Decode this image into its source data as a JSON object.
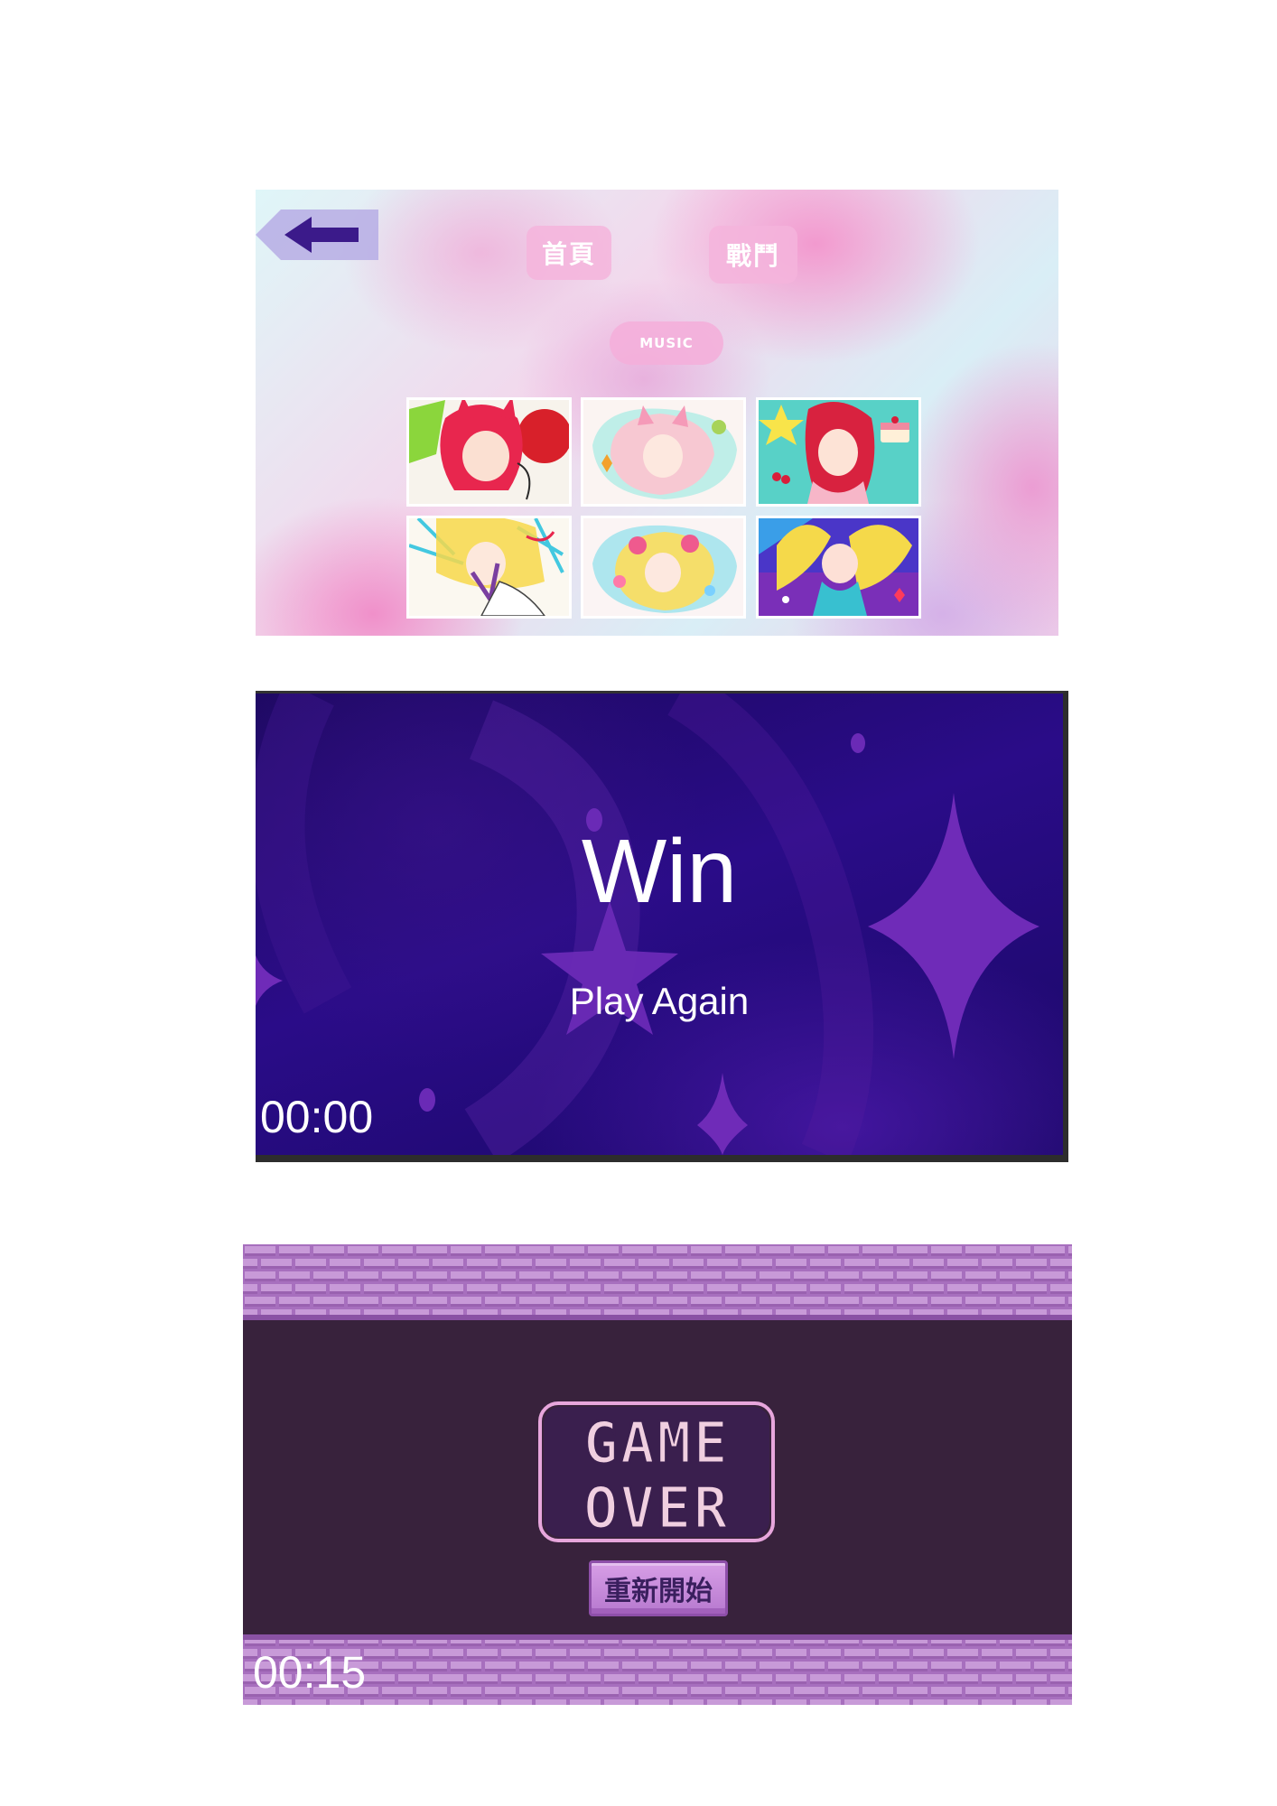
{
  "menu": {
    "back_icon": "left-arrow-icon",
    "home_label": "首頁",
    "battle_label": "戰鬥",
    "music_label": "MUSIC",
    "thumbnails": [
      {
        "name": "red-cat-girl-strawberry-art"
      },
      {
        "name": "pink-cat-girl-bowl-art"
      },
      {
        "name": "red-hair-girl-cake-art"
      },
      {
        "name": "blonde-girl-sketch-art"
      },
      {
        "name": "blonde-pink-girl-candy-art"
      },
      {
        "name": "blonde-twin-tails-girl-art"
      }
    ],
    "colors": {
      "button_pink": "#f4b4dc",
      "arrow": "#3b1a8a"
    }
  },
  "win_screen": {
    "title": "Win",
    "play_again_label": "Play Again",
    "timer": "00:00",
    "colors": {
      "background": "#2a0c88",
      "star": "#6f2bb8"
    }
  },
  "game_over_screen": {
    "logo_text_line1": "GAME",
    "logo_text_line2": "OVER",
    "restart_label": "重新開始",
    "timer": "00:15",
    "colors": {
      "background": "#38223c",
      "brick": "#b079c4",
      "logo_fill": "#f0cfe0",
      "logo_outline": "#3a1f4e"
    }
  }
}
